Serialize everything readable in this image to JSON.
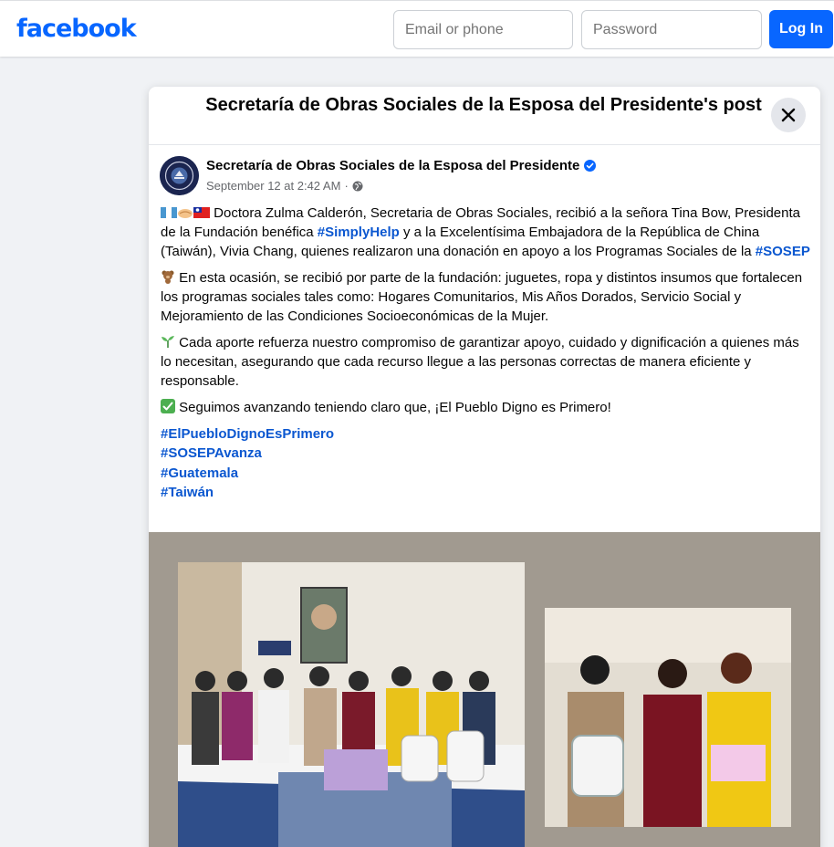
{
  "header": {
    "logo": "facebook",
    "email_placeholder": "Email or phone",
    "password_placeholder": "Password",
    "login_label": "Log In"
  },
  "modal": {
    "title": "Secretaría de Obras Sociales de la Esposa del Presidente's post"
  },
  "post": {
    "author": "Secretaría de Obras Sociales de la Esposa del Presidente",
    "date": "September 12 at 2:42 AM",
    "separator": "·",
    "p1_a": " Doctora Zulma Calderón, Secretaria de Obras Sociales, recibió a la señora Tina Bow, Presidenta de la Fundación benéfica ",
    "p1_tag1": "#SimplyHelp",
    "p1_b": " y a la Excelentísima Embajadora de la República de China (Taiwán), Vivia Chang, quienes realizaron una donación en apoyo a los Programas Sociales de la ",
    "p1_tag2": "#SOSEP",
    "p2": " En esta ocasión, se recibió por parte de la fundación: juguetes, ropa y distintos insumos que fortalecen los programas sociales tales como: Hogares Comunitarios, Mis Años Dorados, Servicio Social y Mejoramiento de las Condiciones Socioeconómicas de la Mujer.",
    "p3": " Cada aporte refuerza nuestro compromiso de garantizar apoyo, cuidado y dignificación a quienes más lo necesitan, asegurando que cada recurso llegue a las personas correctas de manera eficiente y responsable.",
    "p4": " Seguimos avanzando teniendo claro que, ¡El Pueblo Digno es Primero!",
    "hashtags": [
      "#ElPuebloDignoEsPrimero",
      "#SOSEPAvanza",
      "#Guatemala",
      "#Taiwán"
    ],
    "emoji_icons": [
      "guatemala-flag-icon",
      "handshake-icon",
      "taiwan-flag-icon",
      "teddy-bear-icon",
      "seedling-icon",
      "check-mark-icon"
    ]
  },
  "colors": {
    "brand": "#0866ff",
    "hashtag": "#0b57d0",
    "page_bg": "#f0f2f5",
    "photo_bg": "#a19a90"
  }
}
